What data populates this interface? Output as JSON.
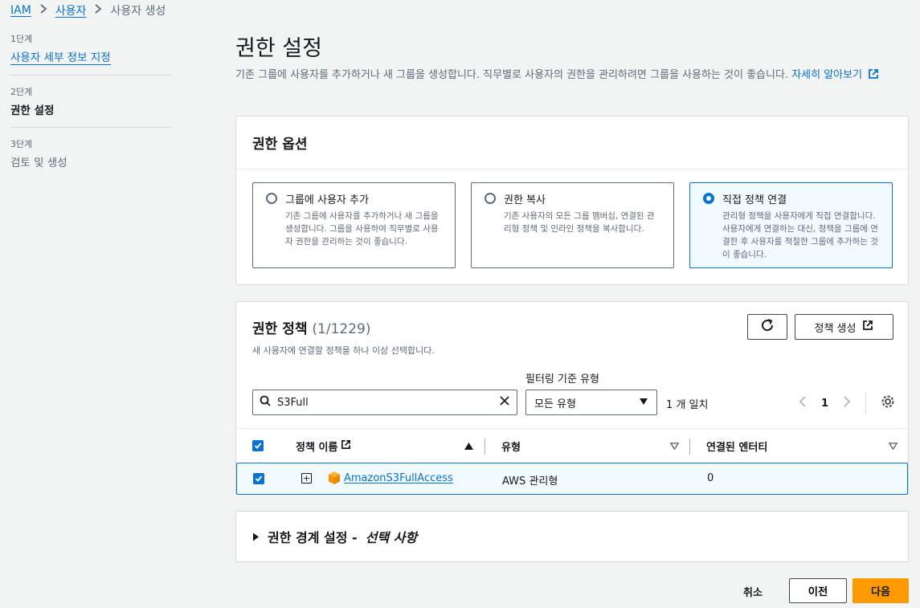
{
  "breadcrumb": [
    {
      "label": "IAM"
    },
    {
      "label": "사용자"
    },
    {
      "label": "사용자 생성"
    }
  ],
  "steps": [
    {
      "num": "1단계",
      "title": "사용자 세부 정보 지정"
    },
    {
      "num": "2단계",
      "title": "권한 설정"
    },
    {
      "num": "3단계",
      "title": "검토 및 생성"
    }
  ],
  "header": {
    "title": "권한 설정",
    "description": "기존 그룹에 사용자를 추가하거나 새 그룹을 생성합니다. 직무별로 사용자의 권한을 관리하려면 그룹을 사용하는 것이 좋습니다.",
    "learn_more": "자세히 알아보기"
  },
  "permission_options": {
    "title": "권한 옵션",
    "options": [
      {
        "title": "그룹에 사용자 추가",
        "desc": "기존 그룹에 사용자를 추가하거나 새 그룹을 생성합니다. 그룹을 사용하여 직무별로 사용자 권한을 관리하는 것이 좋습니다.",
        "selected": false
      },
      {
        "title": "권한 복사",
        "desc": "기존 사용자의 모든 그룹 멤버십, 연결된 관리형 정책 및 인라인 정책을 복사합니다.",
        "selected": false
      },
      {
        "title": "직접 정책 연결",
        "desc": "관리형 정책을 사용자에게 직접 연결합니다. 사용자에게 연결하는 대신, 정책을 그룹에 연결한 후 사용자를 적절한 그룹에 추가하는 것이 좋습니다.",
        "selected": true
      }
    ]
  },
  "policies": {
    "title": "권한 정책",
    "count": "(1/1229)",
    "subtitle": "새 사용자에 연결할 정책을 하나 이상 선택합니다.",
    "create_label": "정책 생성",
    "filter_type_label": "필터링 기준 유형",
    "search_value": "S3Full",
    "filter_type_value": "모든 유형",
    "match_text": "1 개 일치",
    "page": "1",
    "columns": {
      "name": "정책 이름",
      "type": "유형",
      "entities": "연결된 엔터티"
    },
    "rows": [
      {
        "name": "AmazonS3FullAccess",
        "type": "AWS 관리형",
        "entities": "0"
      }
    ]
  },
  "boundary": {
    "prefix": "권한 경계 설정 -",
    "suffix": "선택 사항"
  },
  "footer": {
    "cancel": "취소",
    "previous": "이전",
    "next": "다음"
  },
  "colors": {
    "link": "#0972d3",
    "primary_button": "#ff9900"
  }
}
